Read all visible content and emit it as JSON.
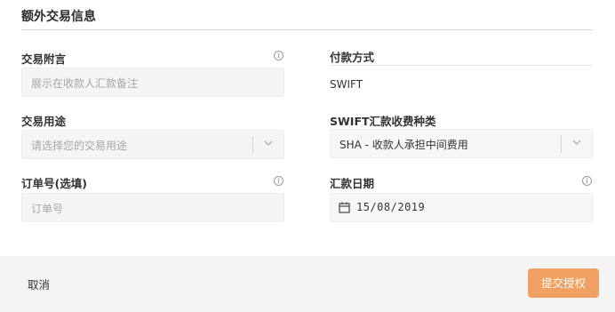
{
  "section": {
    "title": "额外交易信息"
  },
  "remark": {
    "label": "交易附言",
    "placeholder": "展示在收款人汇款备注",
    "info_icon": "info-icon"
  },
  "purpose": {
    "label": "交易用途",
    "placeholder": "请选择您的交易用途",
    "dropdown_icon": "chevron-down-icon"
  },
  "order": {
    "label": "订单号(选填)",
    "placeholder": "订单号",
    "info_icon": "info-icon"
  },
  "payment_method": {
    "label": "付款方式",
    "value": "SWIFT"
  },
  "fee_type": {
    "label": "SWIFT汇款收费种类",
    "value": "SHA - 收款人承担中间费用",
    "dropdown_icon": "chevron-down-icon"
  },
  "remit_date": {
    "label": "汇款日期",
    "value": "15/08/2019",
    "calendar_icon": "calendar-icon",
    "info_icon": "info-icon"
  },
  "footer": {
    "cancel_label": "取消",
    "submit_label": "提交授权"
  },
  "colors": {
    "accent": "#f0a062",
    "field_bg": "#f5f5f5"
  }
}
